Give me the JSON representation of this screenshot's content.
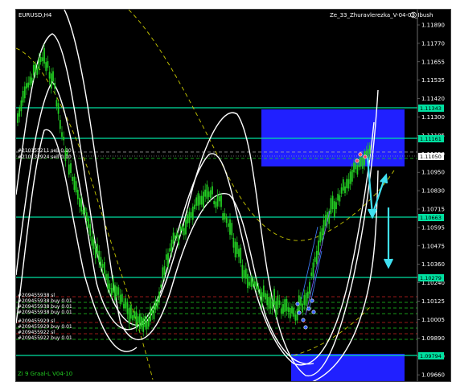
{
  "window": {
    "symbol_label": "EURUSD,H4",
    "indicator_title": "Ze_33_Zhuravlerezka_V-04-03_Ibush",
    "footer_label": "Zi 9 Graal-L V04-10"
  },
  "price_axis": {
    "ticks": [
      "1.11890",
      "1.11770",
      "1.11655",
      "1.11535",
      "1.11420",
      "1.11300",
      "1.11185",
      "1.11050",
      "1.10950",
      "1.10830",
      "1.10715",
      "1.10595",
      "1.10475",
      "1.10360",
      "1.10240",
      "1.10125",
      "1.10005",
      "1.09890",
      "1.09770",
      "1.09660"
    ],
    "highlighted_labels": [
      {
        "value": "1.11343",
        "color": "#00e0a0"
      },
      {
        "value": "1.11161",
        "color": "#00e0a0"
      },
      {
        "value": "1.11050",
        "color": "#ffffff"
      },
      {
        "value": "1.10663",
        "color": "#00e0a0"
      },
      {
        "value": "1.10279",
        "color": "#00e0a0"
      },
      {
        "value": "1.09794",
        "color": "#00e0a0"
      }
    ]
  },
  "orders": {
    "sell": [
      "#210155211 sell 0.10",
      "#210132924 sell 0.10"
    ],
    "group_one": [
      "#209455938 sl",
      "#209455938 buy 0.01",
      "#209455938 buy 0.01",
      "#209455938 buy 0.01"
    ],
    "group_two": [
      "#209455929 sl",
      "#209455929 buy 0.01",
      "#209455922 sl",
      "#209455922 buy 0.01"
    ]
  },
  "colors": {
    "background": "#000000",
    "candles": "#22cc22",
    "levels": "#00e0a0",
    "zone": "#2020ff",
    "arrows": "#40e0f0",
    "envelope": "#ffffff",
    "ma_dashed": "#c8c800"
  },
  "chart_data": {
    "type": "line",
    "title": "EURUSD,H4",
    "ylim": [
      1.0966,
      1.1195
    ],
    "horizontal_levels": [
      1.11343,
      1.11161,
      1.10663,
      1.10279,
      1.09794
    ],
    "current_price": 1.1105
  }
}
